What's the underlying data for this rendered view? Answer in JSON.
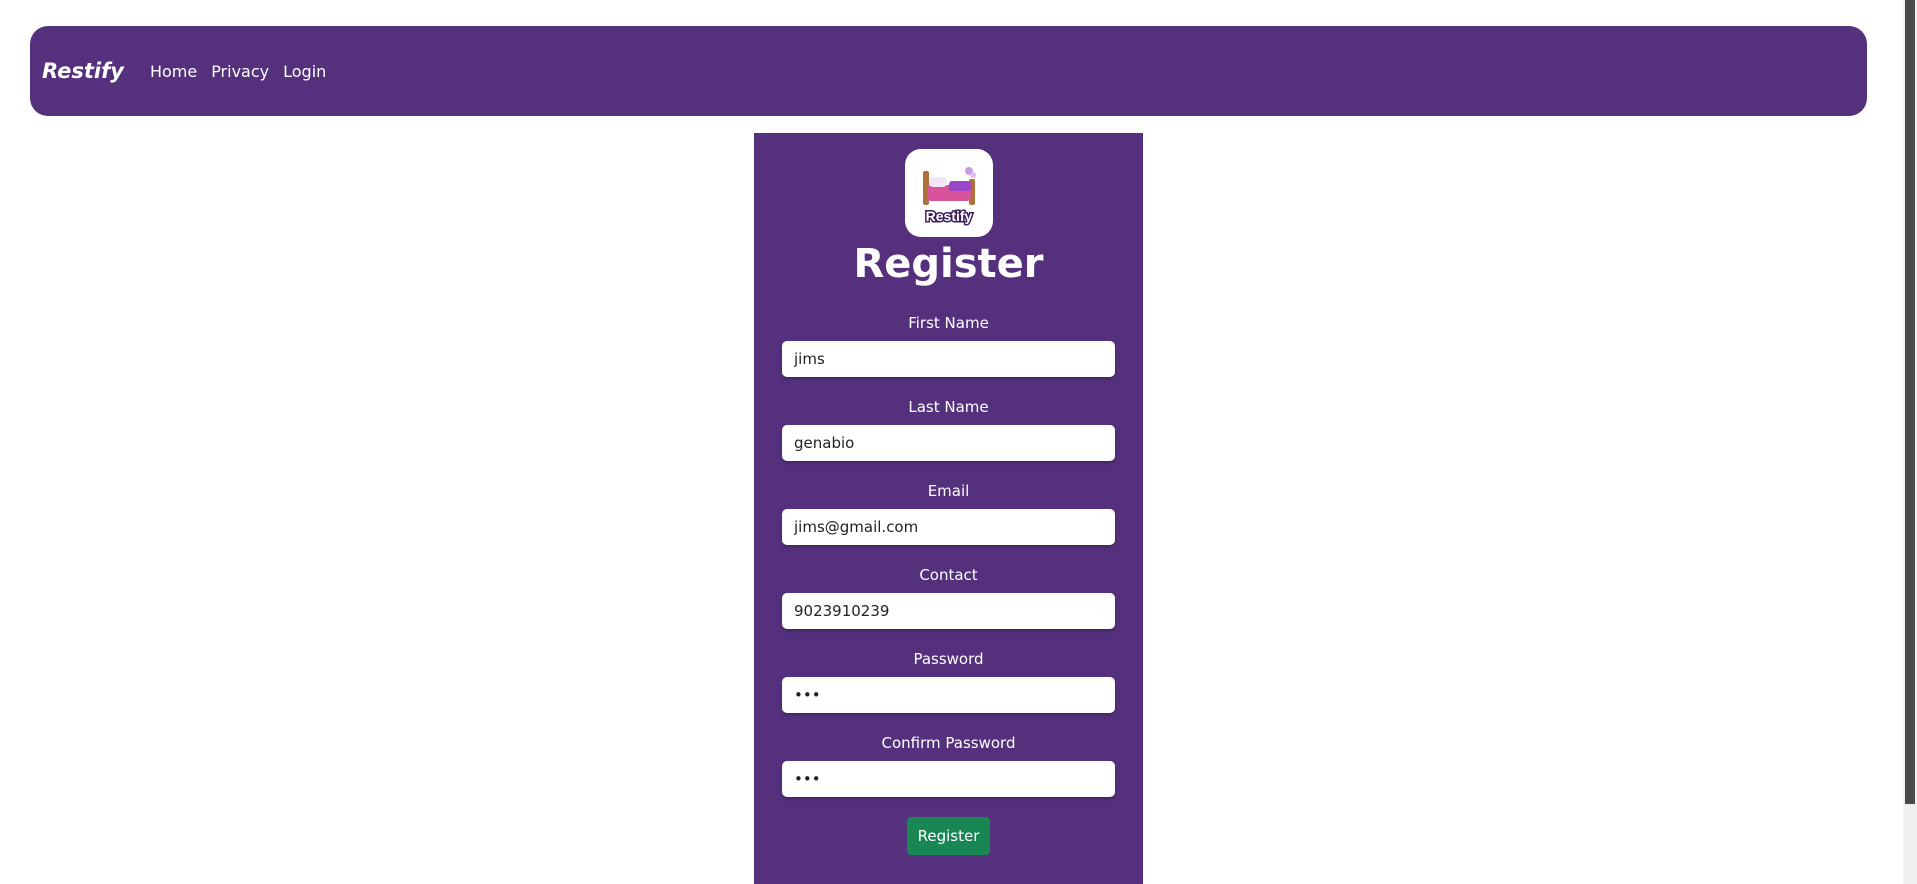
{
  "navbar": {
    "brand": "Restify",
    "links": [
      "Home",
      "Privacy",
      "Login"
    ]
  },
  "logo": {
    "text": "Restify",
    "icon": "bed-icon"
  },
  "form": {
    "title": "Register",
    "fields": [
      {
        "label": "First Name",
        "value": "jims",
        "type": "text"
      },
      {
        "label": "Last Name",
        "value": "genabio",
        "type": "text"
      },
      {
        "label": "Email",
        "value": "jims@gmail.com",
        "type": "text"
      },
      {
        "label": "Contact",
        "value": "9023910239",
        "type": "text"
      },
      {
        "label": "Password",
        "value": "abc",
        "type": "password"
      },
      {
        "label": "Confirm Password",
        "value": "abc",
        "type": "password"
      }
    ],
    "submit_label": "Register"
  },
  "colors": {
    "primary": "#55317d",
    "button": "#198754",
    "background": "#ffffff"
  }
}
